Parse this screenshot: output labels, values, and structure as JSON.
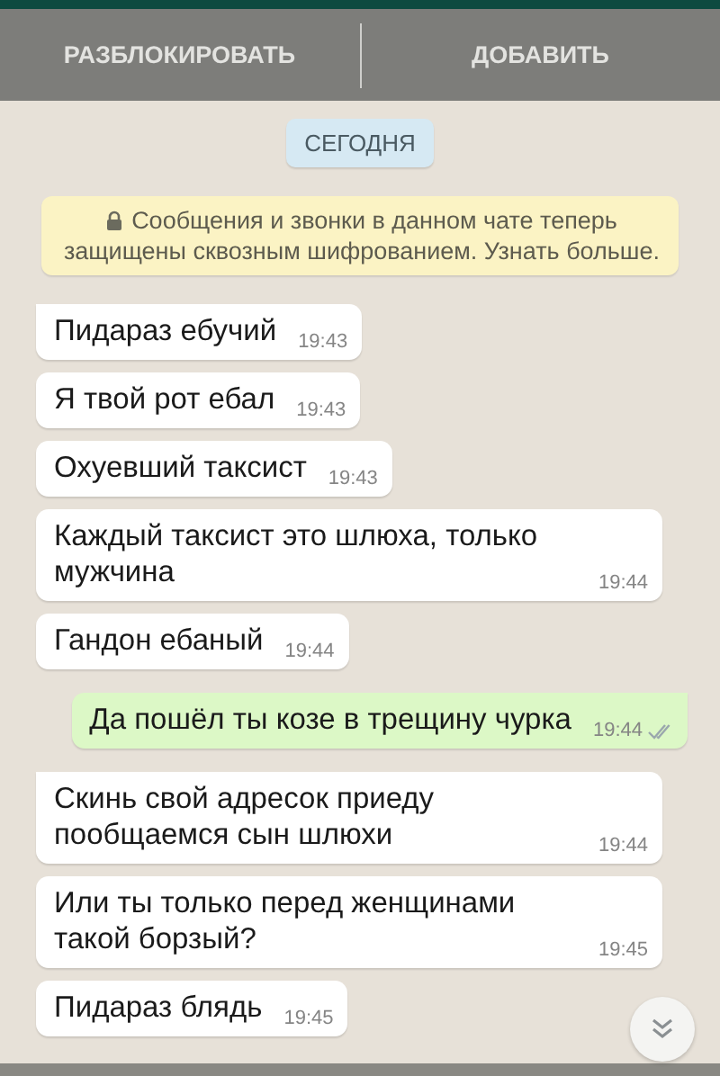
{
  "action_bar": {
    "buttons": [
      {
        "label": "РАЗБЛОКИРОВАТЬ"
      },
      {
        "label": "ДОБАВИТЬ"
      }
    ]
  },
  "date_chip": "СЕГОДНЯ",
  "encryption_notice": "Сообщения и звонки в данном чате теперь защищены сквозным шифрованием. Узнать больше.",
  "messages": [
    {
      "kind": "incoming",
      "text": "Пидараз ебучий",
      "time": "19:43",
      "tail": true
    },
    {
      "kind": "incoming",
      "text": "Я твой рот ебал",
      "time": "19:43",
      "tail": false
    },
    {
      "kind": "incoming",
      "text": "Охуевший таксист",
      "time": "19:43",
      "tail": false
    },
    {
      "kind": "incoming",
      "text": "Каждый таксист это шлюха, только мужчина",
      "time": "19:44",
      "tail": false
    },
    {
      "kind": "incoming",
      "text": "Гандон ебаный",
      "time": "19:44",
      "tail": false
    },
    {
      "kind": "outgoing",
      "text": "Да пошёл ты козе в трещину чурка",
      "time": "19:44",
      "tail": true,
      "read": false
    },
    {
      "kind": "incoming",
      "text": "Скинь свой адресок приеду пообщаемся сын шлюхи",
      "time": "19:44",
      "tail": true
    },
    {
      "kind": "incoming",
      "text": "Или ты только перед женщинами такой борзый?",
      "time": "19:45",
      "tail": false
    },
    {
      "kind": "incoming",
      "text": "Пидараз блядь",
      "time": "19:45",
      "tail": false
    }
  ]
}
